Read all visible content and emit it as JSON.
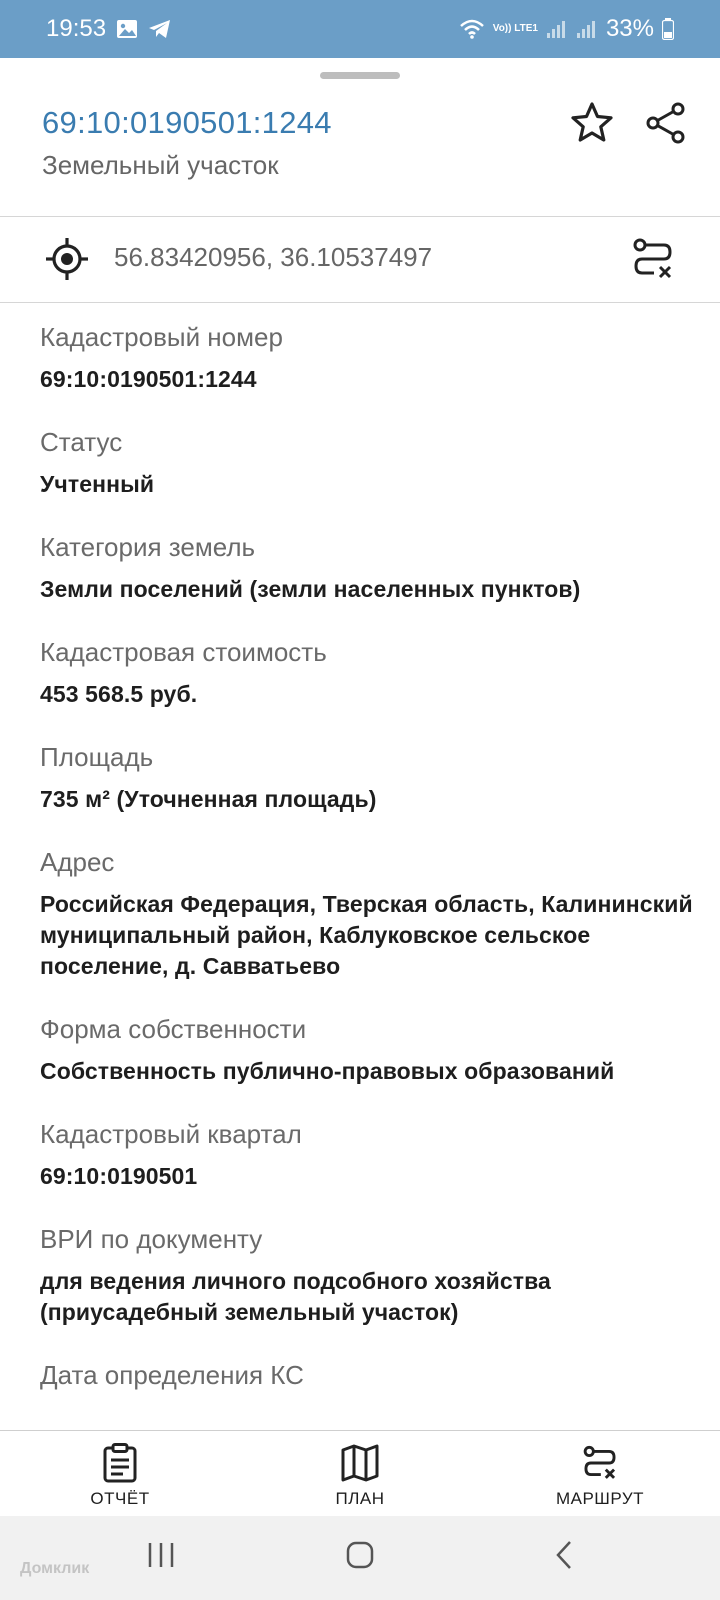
{
  "status_bar": {
    "time": "19:53",
    "network_label": "Vo)) LTE1",
    "battery": "33%"
  },
  "header": {
    "cadastral_number": "69:10:0190501:1244",
    "object_type": "Земельный участок"
  },
  "location": {
    "coordinates": "56.83420956, 36.10537497"
  },
  "properties": [
    {
      "label": "Кадастровый номер",
      "value": "69:10:0190501:1244"
    },
    {
      "label": "Статус",
      "value": "Учтенный"
    },
    {
      "label": "Категория земель",
      "value": "Земли поселений (земли населенных пунктов)"
    },
    {
      "label": "Кадастровая стоимость",
      "value": "453 568.5 руб."
    },
    {
      "label": "Площадь",
      "value": "735 м² (Уточненная площадь)"
    },
    {
      "label": "Адрес",
      "value": "Российская Федерация, Тверская область, Калининский муниципальный район, Каблуковское сельское поселение, д. Савватьево"
    },
    {
      "label": "Форма собственности",
      "value": "Собственность публично-правовых образований"
    },
    {
      "label": "Кадастровый квартал",
      "value": "69:10:0190501"
    },
    {
      "label": "ВРИ по документу",
      "value": "для ведения личного подсобного хозяйства (приусадебный земельный участок)"
    },
    {
      "label": "Дата определения КС",
      "value": ""
    }
  ],
  "bottom_nav": {
    "report": "ОТЧЁТ",
    "plan": "ПЛАН",
    "route": "МАРШРУТ"
  },
  "watermark": "Домклик",
  "colors": {
    "status_bar": "#6b9ec7",
    "accent_link": "#3a7cb0",
    "label_gray": "#6a6a6a"
  }
}
